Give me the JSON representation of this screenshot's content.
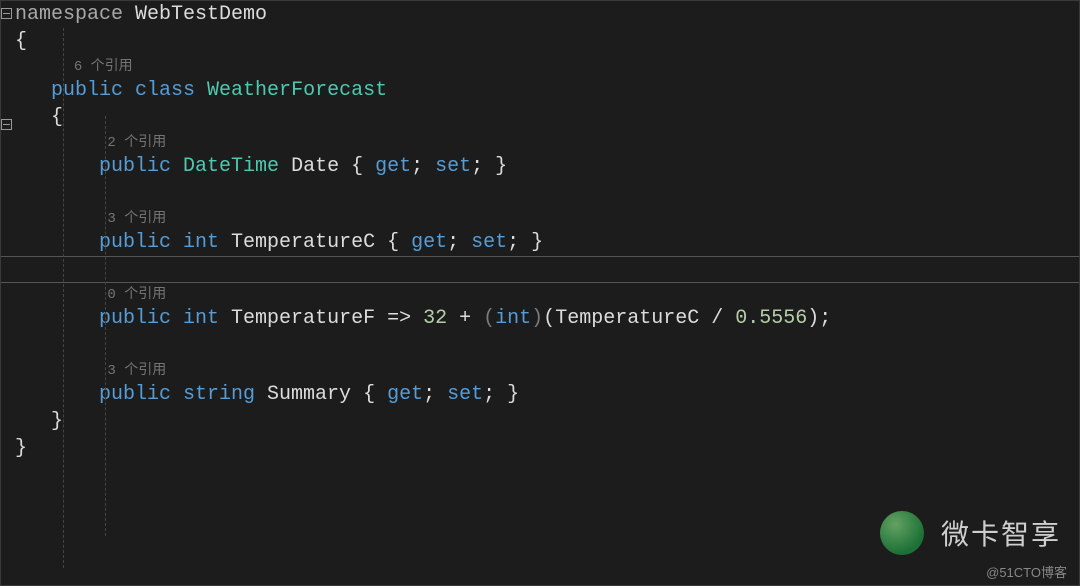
{
  "code": {
    "namespace_kw": "namespace",
    "namespace_name": " WebTestDemo",
    "open_brace": "{",
    "close_brace": "}",
    "refs_class": "6 个引用",
    "class_decl_public": "public",
    "class_decl_class": " class",
    "class_name": " WeatherForecast",
    "refs_date": "2 个引用",
    "date_public": "public",
    "date_type": " DateTime",
    "date_name": " Date ",
    "accessor_open": "{ ",
    "get_kw": "get",
    "semi": ";",
    "set_kw": " set",
    "accessor_close": " }",
    "refs_tempc": "3 个引用",
    "tempc_public": "public",
    "tempc_type": " int",
    "tempc_name": " TemperatureC ",
    "refs_tempf": "0 个引用",
    "tempf_public": "public",
    "tempf_type": " int",
    "tempf_name": " TemperatureF ",
    "arrow": "=>",
    "num32": " 32 ",
    "plus": "+",
    "cast_open": " (",
    "cast_type": "int",
    "cast_close": ")",
    "paren_open": "(",
    "tempc_ref": "TemperatureC ",
    "div": "/",
    "num05556": " 0.5556",
    "paren_close": ")",
    "stmt_semi": ";",
    "refs_summary": "3 个引用",
    "summary_public": "public",
    "summary_type": " string",
    "summary_name": " Summary "
  },
  "indent": {
    "l1": "   ",
    "l2": "       ",
    "l3": "           "
  },
  "watermark": {
    "text": "微卡智享",
    "credit": "@51CTO博客"
  }
}
